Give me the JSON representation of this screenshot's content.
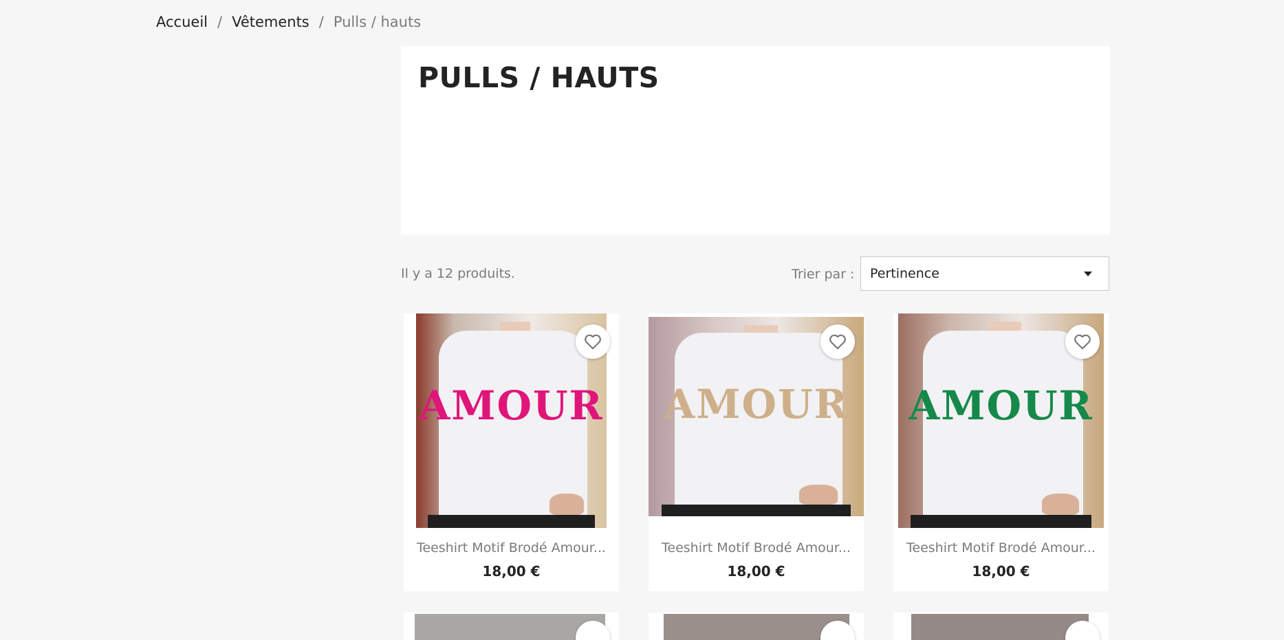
{
  "breadcrumb": {
    "items": [
      "Accueil",
      "Vêtements"
    ],
    "current": "Pulls / hauts",
    "separator": "/"
  },
  "category": {
    "title": "PULLS / HAUTS"
  },
  "listing": {
    "count_text": "Il y a 12 produits.",
    "sort_label": "Trier par :",
    "sort_value": "Pertinence"
  },
  "products": [
    {
      "name": "Teeshirt Motif Brodé Amour...",
      "price": "18,00 €",
      "embroidery": "AMOUR",
      "color": "#e0157a"
    },
    {
      "name": "Teeshirt Motif Brodé Amour...",
      "price": "18,00 €",
      "embroidery": "AMOUR",
      "color": "#cdb08a"
    },
    {
      "name": "Teeshirt Motif Brodé Amour...",
      "price": "18,00 €",
      "embroidery": "AMOUR",
      "color": "#15894a"
    }
  ],
  "icons": {
    "wishlist": "heart-outline-icon",
    "sort": "caret-down-icon"
  },
  "colors": {
    "page_bg": "#f6f6f6",
    "text": "#232323",
    "muted": "#7a7a7a"
  }
}
